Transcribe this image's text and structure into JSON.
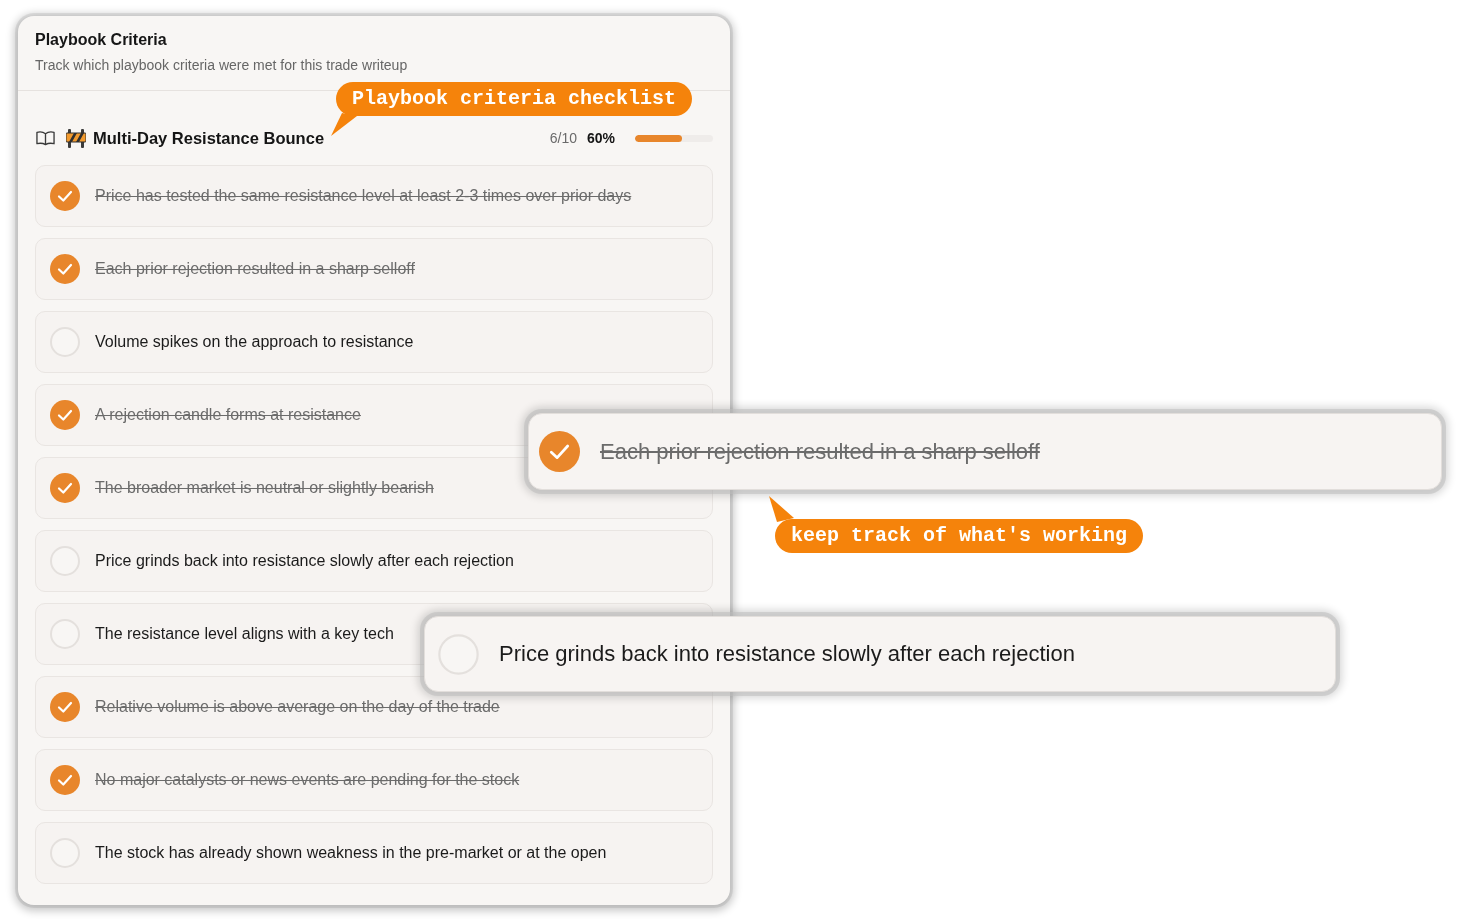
{
  "panel": {
    "title": "Playbook Criteria",
    "subtitle": "Track which playbook criteria were met for this trade writeup"
  },
  "playbook": {
    "name": "Multi-Day Resistance Bounce",
    "count": "6/10",
    "percent": "60%",
    "level": 0.6,
    "criteria": [
      {
        "text": "Price has tested the same resistance level at least 2-3 times over prior days",
        "checked": true
      },
      {
        "text": "Each prior rejection resulted in a sharp selloff",
        "checked": true
      },
      {
        "text": "Volume spikes on the approach to resistance",
        "checked": false
      },
      {
        "text": "A rejection candle forms at resistance",
        "checked": true
      },
      {
        "text": "The broader market is neutral or slightly bearish",
        "checked": true
      },
      {
        "text": "Price grinds back into resistance slowly after each rejection",
        "checked": false
      },
      {
        "text": "The resistance level aligns with a key tech",
        "checked": false
      },
      {
        "text": "Relative volume is above average on the day of the trade",
        "checked": true
      },
      {
        "text": "No major catalysts or news events are pending for the stock",
        "checked": true
      },
      {
        "text": "The stock has already shown weakness in the pre-market or at the open",
        "checked": false
      }
    ]
  },
  "zoomed_criteria": [
    {
      "text": "Each prior rejection resulted in a sharp selloff",
      "checked": true
    },
    {
      "text": "Price grinds back into resistance slowly after each rejection",
      "checked": false
    }
  ],
  "callouts": [
    {
      "text": "Playbook criteria checklist",
      "kind": "down"
    },
    {
      "text": "keep track of what's working",
      "kind": "up"
    }
  ]
}
